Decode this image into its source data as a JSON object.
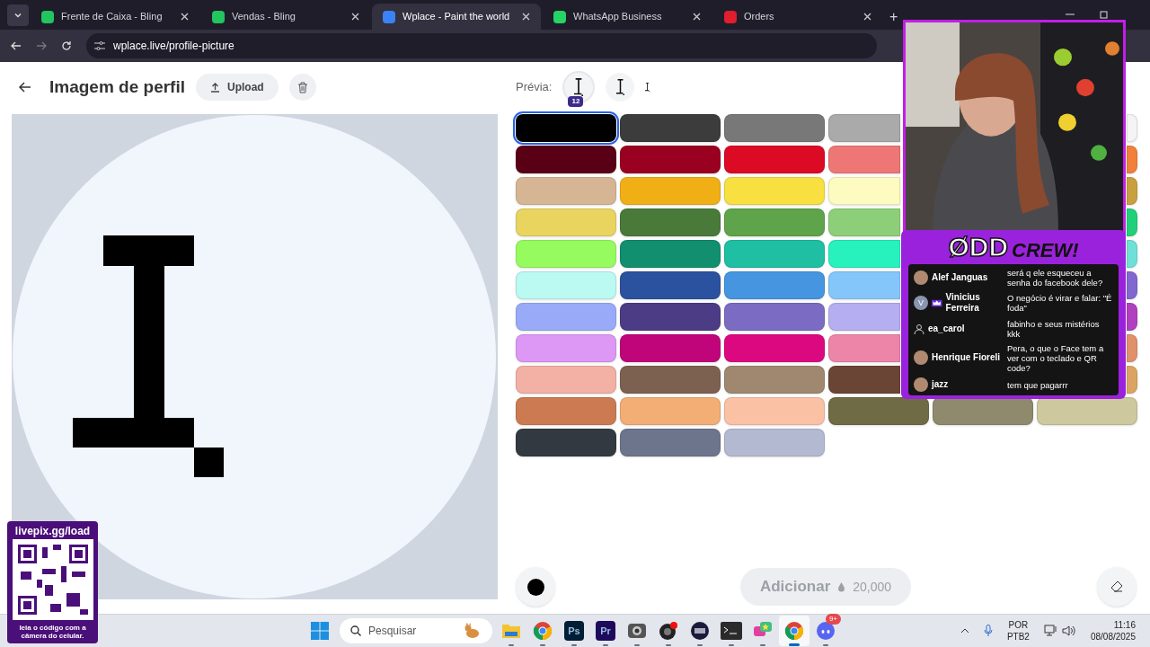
{
  "browser": {
    "tabs": [
      {
        "title": "Frente de Caixa - Bling",
        "selected": false,
        "color": "#22c55e"
      },
      {
        "title": "Vendas - Bling",
        "selected": false,
        "color": "#22c55e"
      },
      {
        "title": "Wplace - Paint the world",
        "selected": true,
        "color": "#3b82f6"
      },
      {
        "title": "WhatsApp Business",
        "selected": false,
        "color": "#25d366"
      },
      {
        "title": "Orders",
        "selected": false,
        "color": "#e11d2e"
      }
    ],
    "tab_add": "+",
    "url": "wplace.live/profile-picture"
  },
  "page": {
    "title": "Imagem de perfil",
    "upload": "Upload",
    "preview_label": "Prévia:",
    "preview_badge": "12",
    "palette": [
      [
        {
          "kind": "full",
          "color": "#000000",
          "selected": true
        },
        {
          "kind": "full",
          "color": "#3c3c3c",
          "selected": false
        },
        {
          "kind": "full",
          "color": "#787878",
          "selected": false
        },
        {
          "kind": "partial",
          "color": "#aaaaaa",
          "selected": false
        },
        {
          "kind": "edge",
          "color": "#f4f4f4",
          "selected": false
        }
      ],
      [
        {
          "kind": "full",
          "color": "#5a0016",
          "selected": false
        },
        {
          "kind": "full",
          "color": "#9a0020",
          "selected": false
        },
        {
          "kind": "full",
          "color": "#dc0a24",
          "selected": false
        },
        {
          "kind": "partial",
          "color": "#ee7674",
          "selected": false
        },
        {
          "kind": "edge",
          "color": "#f0803a",
          "selected": false
        }
      ],
      [
        {
          "kind": "full",
          "color": "#d6b594",
          "selected": false
        },
        {
          "kind": "full",
          "color": "#f0b015",
          "selected": false
        },
        {
          "kind": "full",
          "color": "#f7e040",
          "selected": false
        },
        {
          "kind": "partial",
          "color": "#fefbc0",
          "selected": false
        },
        {
          "kind": "edge",
          "color": "#c9a040",
          "selected": false
        }
      ],
      [
        {
          "kind": "full",
          "color": "#e8d45f",
          "selected": false
        },
        {
          "kind": "full",
          "color": "#4a7a3a",
          "selected": false
        },
        {
          "kind": "full",
          "color": "#5fa34a",
          "selected": false
        },
        {
          "kind": "partial",
          "color": "#8ccf78",
          "selected": false
        },
        {
          "kind": "edge",
          "color": "#22d07a",
          "selected": false
        }
      ],
      [
        {
          "kind": "full",
          "color": "#96fb5e",
          "selected": false
        },
        {
          "kind": "full",
          "color": "#118f6e",
          "selected": false
        },
        {
          "kind": "full",
          "color": "#1fbfa3",
          "selected": false
        },
        {
          "kind": "partial",
          "color": "#27f1bc",
          "selected": false
        },
        {
          "kind": "edge",
          "color": "#6ee0d8",
          "selected": false
        }
      ],
      [
        {
          "kind": "full",
          "color": "#bbfaf2",
          "selected": false
        },
        {
          "kind": "full",
          "color": "#2b529e",
          "selected": false
        },
        {
          "kind": "full",
          "color": "#4695e0",
          "selected": false
        },
        {
          "kind": "partial",
          "color": "#85c6fa",
          "selected": false
        },
        {
          "kind": "edge",
          "color": "#8068d0",
          "selected": false
        }
      ],
      [
        {
          "kind": "full",
          "color": "#99aaf8",
          "selected": false
        },
        {
          "kind": "full",
          "color": "#4c3c85",
          "selected": false
        },
        {
          "kind": "full",
          "color": "#7b6bc2",
          "selected": false
        },
        {
          "kind": "partial",
          "color": "#b5aef1",
          "selected": false
        },
        {
          "kind": "edge",
          "color": "#b040c0",
          "selected": false
        }
      ],
      [
        {
          "kind": "full",
          "color": "#dd98f5",
          "selected": false
        },
        {
          "kind": "full",
          "color": "#c0047a",
          "selected": false
        },
        {
          "kind": "full",
          "color": "#dc0880",
          "selected": false
        },
        {
          "kind": "partial",
          "color": "#ec85a8",
          "selected": false
        },
        {
          "kind": "edge",
          "color": "#e0906a",
          "selected": false
        }
      ],
      [
        {
          "kind": "full",
          "color": "#f3b0a4",
          "selected": false
        },
        {
          "kind": "full",
          "color": "#7c6150",
          "selected": false
        },
        {
          "kind": "full",
          "color": "#a08870",
          "selected": false
        },
        {
          "kind": "partial",
          "color": "#6a4434",
          "selected": false
        },
        {
          "kind": "edge",
          "color": "#dba463",
          "selected": false
        }
      ],
      [
        {
          "kind": "full",
          "color": "#cc7a52",
          "selected": false
        },
        {
          "kind": "full",
          "color": "#f2ae74",
          "selected": false
        },
        {
          "kind": "full",
          "color": "#fbc1a5",
          "selected": false
        },
        {
          "kind": "full",
          "color": "#6f6b45",
          "selected": false
        },
        {
          "kind": "full",
          "color": "#8f8a6d",
          "selected": false
        },
        {
          "kind": "full",
          "color": "#cdc89e",
          "selected": false
        }
      ],
      [
        {
          "kind": "full",
          "color": "#333941",
          "selected": false
        },
        {
          "kind": "full",
          "color": "#6d758d",
          "selected": false
        },
        {
          "kind": "full",
          "color": "#b3b9d1",
          "selected": false
        }
      ]
    ],
    "add_button": {
      "label": "Adicionar",
      "cost": "20,000",
      "disabled": true
    }
  },
  "overlay": {
    "logo": "ØDD",
    "logo_word": "CREW!",
    "chat": [
      {
        "user": "Alef Janguas",
        "text": "será q ele esqueceu a senha do facebook dele?"
      },
      {
        "user": "Vinicius Ferreira",
        "text": "O negócio é virar e falar: \"É foda\"",
        "kind": "letter",
        "letter": "V",
        "badge": true
      },
      {
        "user": "ea_carol",
        "text": "fabinho e seus mistérios kkk",
        "kind": "person"
      },
      {
        "user": "Henrique Fioreli",
        "text": "Pera, o que o Face tem a ver com o teclado e QR code?"
      },
      {
        "user": "jazz",
        "text": "tem que pagarrr"
      }
    ],
    "qr_title": "livepix.gg/load",
    "qr_caption": "leia o código com a câmera do celular."
  },
  "taskbar": {
    "search": "Pesquisar",
    "apps": [
      {
        "kind": "folder"
      },
      {
        "kind": "chrome"
      },
      {
        "kind": "text",
        "label": "Ps",
        "color": "#001e36"
      },
      {
        "kind": "text",
        "label": "Pr",
        "color": "#1e0a5c"
      },
      {
        "kind": "camera"
      },
      {
        "kind": "obs"
      },
      {
        "kind": "keypad"
      },
      {
        "kind": "terminal"
      },
      {
        "kind": "chat"
      },
      {
        "kind": "chrome",
        "active": true
      },
      {
        "kind": "discord",
        "badge": "9+"
      }
    ],
    "lang": "POR",
    "layout": "PTB2",
    "time": "11:16",
    "date": "08/08/2025"
  }
}
